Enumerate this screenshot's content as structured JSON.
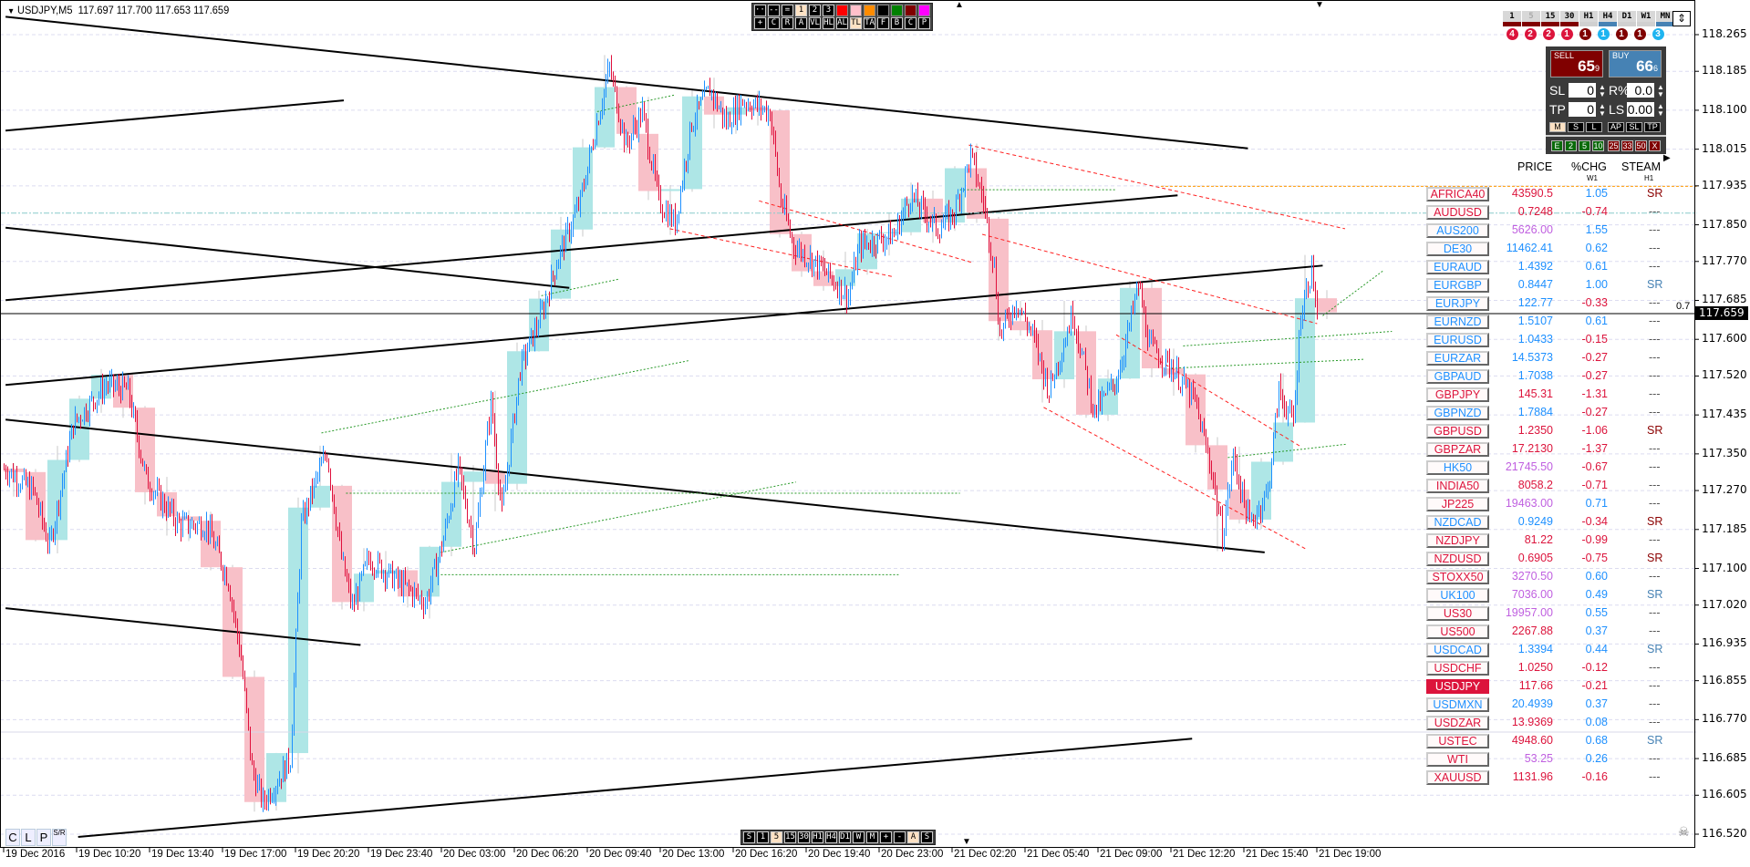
{
  "chart": {
    "symbol_title": "USDJPY,M5",
    "ohlc": "117.697 117.700 117.653 117.659",
    "current_price": "117.659",
    "level_label": "0.7",
    "price_axis": [
      "118.265",
      "118.185",
      "118.100",
      "118.015",
      "117.935",
      "117.850",
      "117.770",
      "117.685",
      "117.600",
      "117.520",
      "117.435",
      "117.350",
      "117.270",
      "117.185",
      "117.100",
      "117.020",
      "116.935",
      "116.855",
      "116.770",
      "116.685",
      "116.605",
      "116.520"
    ],
    "time_axis": [
      "19 Dec 2016",
      "19 Dec 10:20",
      "19 Dec 13:40",
      "19 Dec 17:00",
      "19 Dec 20:20",
      "19 Dec 23:40",
      "20 Dec 03:00",
      "20 Dec 06:20",
      "20 Dec 09:40",
      "20 Dec 13:00",
      "20 Dec 16:20",
      "20 Dec 19:40",
      "20 Dec 23:00",
      "21 Dec 02:20",
      "21 Dec 05:40",
      "21 Dec 09:00",
      "21 Dec 12:20",
      "21 Dec 15:40",
      "21 Dec 19:00"
    ],
    "price_path": [
      117.318,
      117.27,
      117.148,
      117.416,
      117.501,
      117.489,
      117.294,
      117.196,
      117.196,
      117.075,
      116.904,
      116.661,
      116.588,
      116.685,
      117.196,
      117.27,
      117.355,
      117.123,
      117.014,
      117.123,
      117.075,
      117.026,
      117.148,
      117.318,
      117.148,
      117.464,
      117.221,
      117.537,
      117.659,
      117.781,
      117.902,
      118.073,
      118.194,
      118.024,
      118.097,
      117.902,
      117.854,
      118.073,
      118.146,
      118.073,
      118.121,
      118.097,
      117.902,
      117.805,
      117.756,
      117.695,
      117.805,
      117.829,
      117.914,
      117.841,
      117.878,
      118.0,
      117.902,
      117.756,
      117.61,
      117.683,
      117.61,
      117.489,
      117.659,
      117.44,
      117.513,
      117.61,
      117.72,
      117.586,
      117.537,
      117.464,
      117.318,
      117.172,
      117.343,
      117.196,
      117.27,
      117.489,
      117.416,
      117.659,
      117.756,
      117.659
    ],
    "colors": {
      "bull": "#1e90ff",
      "bear": "#e0103c",
      "bull_h1": "#aee6e6",
      "bear_h1": "#f8c0c8"
    }
  },
  "top_toolbar": {
    "row1": [
      "···",
      "--",
      "=",
      "1",
      "2",
      "3"
    ],
    "swatches": [
      "#ff0000",
      "#ffc0cb",
      "#ff8c00",
      "#000000",
      "#008000",
      "#800000",
      "#ff00ff"
    ],
    "row2": [
      "+",
      "C",
      "R",
      "A",
      "VL",
      "HL",
      "AL",
      "TL",
      "TA",
      "F",
      "B",
      "C",
      "P"
    ],
    "active_row1": "1",
    "active_row2": "TL"
  },
  "bottom_toolbar": {
    "items": [
      "S",
      "1",
      "5",
      "15",
      "30",
      "H1",
      "H4",
      "D1",
      "W",
      "M",
      "+",
      "-",
      "A",
      "S"
    ],
    "active": [
      "5",
      "A"
    ]
  },
  "clp": [
    "C",
    "L",
    "P",
    "S/R"
  ],
  "timeframes": {
    "labels": [
      "1",
      "5",
      "15",
      "30",
      "H1",
      "H4",
      "D1",
      "W1",
      "MN"
    ],
    "bars": [
      "#800000",
      "#800000",
      "#800000",
      "#800000",
      "#d0d0d0",
      "#4682b4",
      "#d0d0d0",
      "#d0d0d0",
      "#4682b4"
    ],
    "counts": [
      "4",
      "2",
      "2",
      "1",
      "1",
      "1",
      "1",
      "1",
      "3"
    ],
    "count_colors": [
      "#dc143c",
      "#dc143c",
      "#dc143c",
      "#dc143c",
      "#800000",
      "#1eb4f0",
      "#800000",
      "#800000",
      "#1eb4f0"
    ]
  },
  "trade_panel": {
    "sell_label": "SELL",
    "sell_big": "65",
    "sell_small": "9",
    "buy_label": "BUY",
    "buy_big": "66",
    "buy_small": "6",
    "sl_label": "SL",
    "sl_value": "0",
    "tp_label": "TP",
    "tp_value": "0",
    "risk_label": "R%",
    "risk_value": "0.0",
    "lots_label": "LS",
    "lots_value": "0.00",
    "mode_buttons": [
      "M",
      "S",
      "L",
      "AP",
      "SL",
      "TP"
    ],
    "close_buttons_green": [
      "E",
      "2",
      "5",
      "10"
    ],
    "close_buttons_red": [
      "25",
      "33",
      "50",
      "X"
    ],
    "sell_color": "#800000",
    "buy_color": "#4682b4"
  },
  "scanner": {
    "headers": {
      "price": "PRICE",
      "chg": "%CHG",
      "chg_sub": "W1",
      "steam": "STEAM",
      "steam_sub": "H1"
    },
    "palette": {
      "r": "#dc143c",
      "b": "#1e90ff",
      "p": "#c060e0",
      "d": "#8b0000",
      "s": "#4682b4"
    },
    "rows": [
      {
        "symbol": "AFRICA40",
        "price": "43590.5",
        "chg": "1.05",
        "steam": "SR",
        "c": "rrbd"
      },
      {
        "symbol": "AUDUSD",
        "price": "0.7248",
        "chg": "-0.74",
        "steam": "---",
        "c": "rrrd"
      },
      {
        "symbol": "AUS200",
        "price": "5626.00",
        "chg": "1.55",
        "steam": "---",
        "c": "bpbd"
      },
      {
        "symbol": "DE30",
        "price": "11462.41",
        "chg": "0.62",
        "steam": "---",
        "c": "bbbd"
      },
      {
        "symbol": "EURAUD",
        "price": "1.4392",
        "chg": "0.61",
        "steam": "---",
        "c": "bbbd"
      },
      {
        "symbol": "EURGBP",
        "price": "0.8447",
        "chg": "1.00",
        "steam": "SR",
        "c": "bbbs"
      },
      {
        "symbol": "EURJPY",
        "price": "122.77",
        "chg": "-0.33",
        "steam": "---",
        "c": "bbrd"
      },
      {
        "symbol": "EURNZD",
        "price": "1.5107",
        "chg": "0.61",
        "steam": "---",
        "c": "bbbd"
      },
      {
        "symbol": "EURUSD",
        "price": "1.0433",
        "chg": "-0.15",
        "steam": "---",
        "c": "bbrd"
      },
      {
        "symbol": "EURZAR",
        "price": "14.5373",
        "chg": "-0.27",
        "steam": "---",
        "c": "bbrd"
      },
      {
        "symbol": "GBPAUD",
        "price": "1.7038",
        "chg": "-0.27",
        "steam": "---",
        "c": "bbrd"
      },
      {
        "symbol": "GBPJPY",
        "price": "145.31",
        "chg": "-1.31",
        "steam": "---",
        "c": "rrrd"
      },
      {
        "symbol": "GBPNZD",
        "price": "1.7884",
        "chg": "-0.27",
        "steam": "---",
        "c": "bbrd"
      },
      {
        "symbol": "GBPUSD",
        "price": "1.2350",
        "chg": "-1.06",
        "steam": "SR",
        "c": "rrrd"
      },
      {
        "symbol": "GBPZAR",
        "price": "17.2130",
        "chg": "-1.37",
        "steam": "---",
        "c": "rrrd"
      },
      {
        "symbol": "HK50",
        "price": "21745.50",
        "chg": "-0.67",
        "steam": "---",
        "c": "bprd"
      },
      {
        "symbol": "INDIA50",
        "price": "8058.2",
        "chg": "-0.71",
        "steam": "---",
        "c": "rrrd"
      },
      {
        "symbol": "JP225",
        "price": "19463.00",
        "chg": "0.71",
        "steam": "---",
        "c": "rpbd"
      },
      {
        "symbol": "NZDCAD",
        "price": "0.9249",
        "chg": "-0.34",
        "steam": "SR",
        "c": "bbrd"
      },
      {
        "symbol": "NZDJPY",
        "price": "81.22",
        "chg": "-0.99",
        "steam": "---",
        "c": "rrrd"
      },
      {
        "symbol": "NZDUSD",
        "price": "0.6905",
        "chg": "-0.75",
        "steam": "SR",
        "c": "rrrd"
      },
      {
        "symbol": "STOXX50",
        "price": "3270.50",
        "chg": "0.60",
        "steam": "---",
        "c": "rpbd"
      },
      {
        "symbol": "UK100",
        "price": "7036.00",
        "chg": "0.49",
        "steam": "SR",
        "c": "bpbs"
      },
      {
        "symbol": "US30",
        "price": "19957.00",
        "chg": "0.55",
        "steam": "---",
        "c": "rpbd"
      },
      {
        "symbol": "US500",
        "price": "2267.88",
        "chg": "0.37",
        "steam": "---",
        "c": "rrbd"
      },
      {
        "symbol": "USDCAD",
        "price": "1.3394",
        "chg": "0.44",
        "steam": "SR",
        "c": "bbbs"
      },
      {
        "symbol": "USDCHF",
        "price": "1.0250",
        "chg": "-0.12",
        "steam": "---",
        "c": "rrrd"
      },
      {
        "symbol": "USDJPY",
        "price": "117.66",
        "chg": "-0.21",
        "steam": "---",
        "c": "rrrd",
        "selected": true
      },
      {
        "symbol": "USDMXN",
        "price": "20.4939",
        "chg": "0.37",
        "steam": "---",
        "c": "bbbd"
      },
      {
        "symbol": "USDZAR",
        "price": "13.9369",
        "chg": "0.08",
        "steam": "---",
        "c": "rrbd"
      },
      {
        "symbol": "USTEC",
        "price": "4948.60",
        "chg": "0.68",
        "steam": "SR",
        "c": "rrbs"
      },
      {
        "symbol": "WTI",
        "price": "53.25",
        "chg": "0.26",
        "steam": "---",
        "c": "rpbd"
      },
      {
        "symbol": "XAUUSD",
        "price": "1131.96",
        "chg": "-0.16",
        "steam": "---",
        "c": "rrrd"
      }
    ]
  }
}
